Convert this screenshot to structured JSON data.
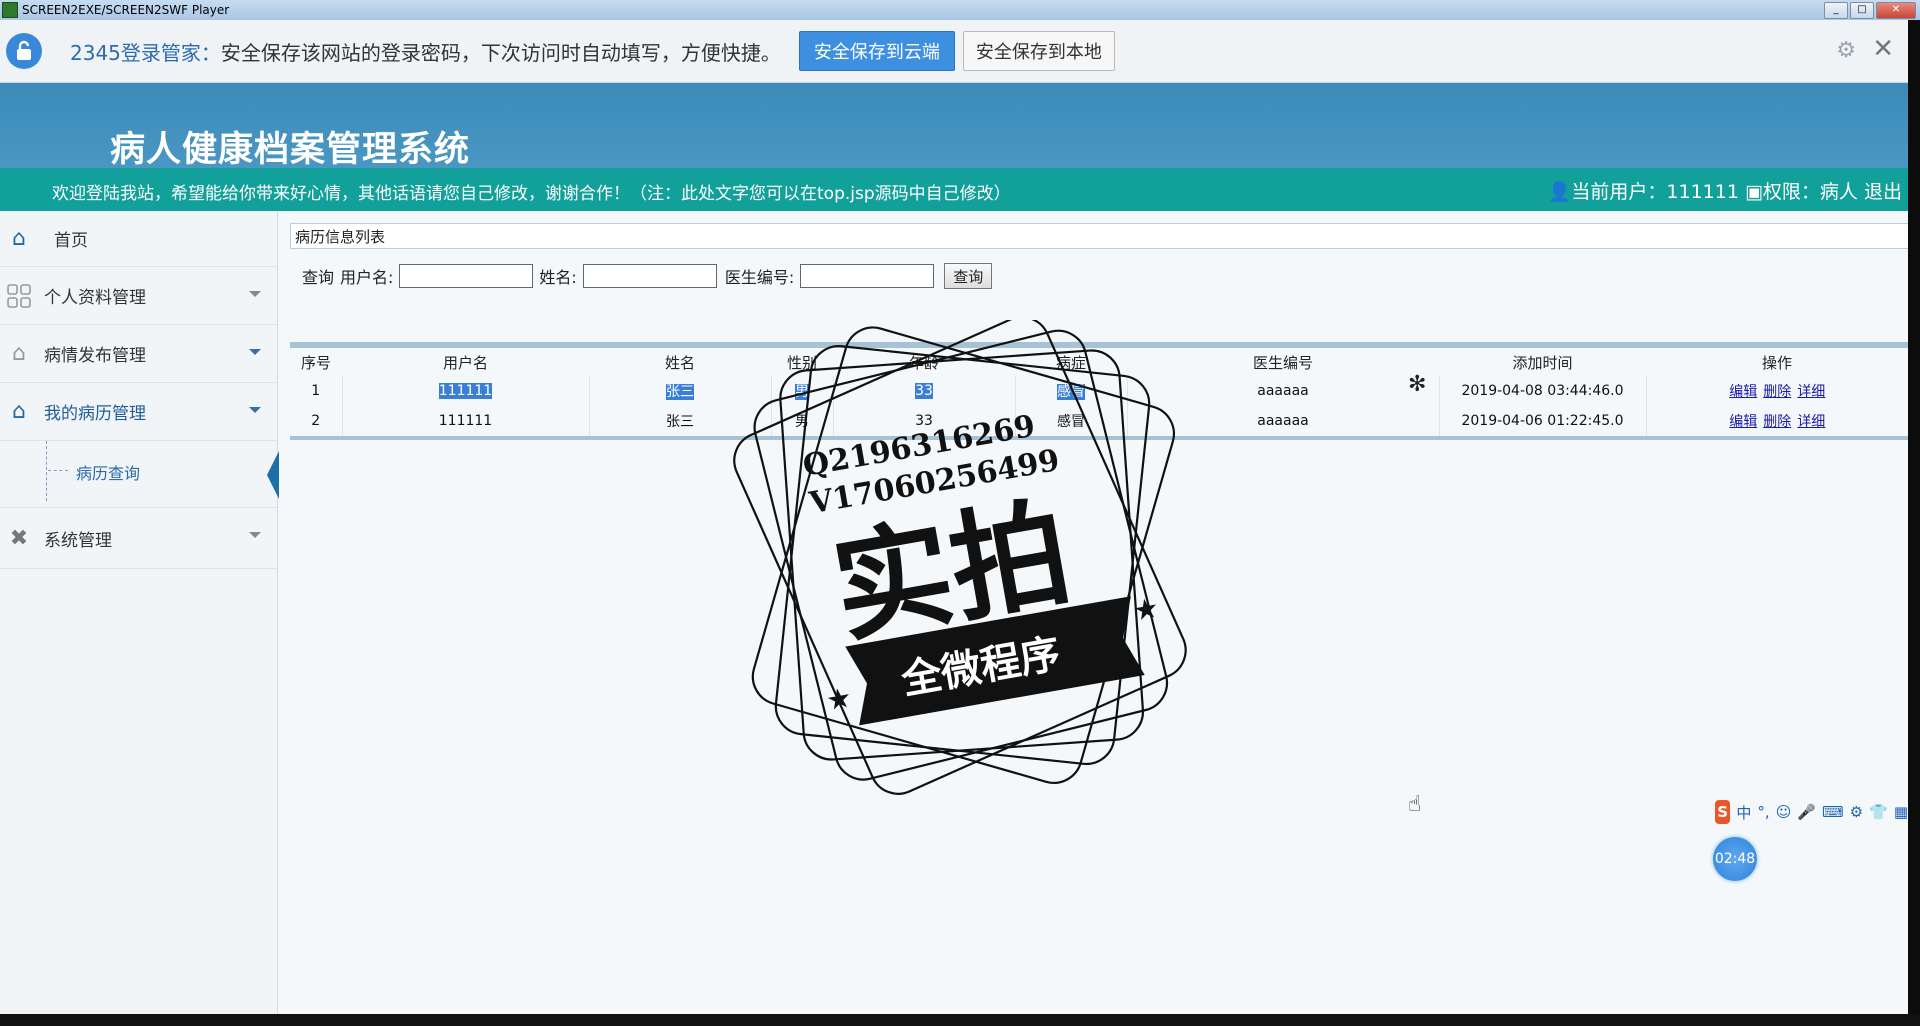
{
  "window": {
    "title": "SCREEN2EXE/SCREEN2SWF Player"
  },
  "password_bar": {
    "brand": "2345登录管家：",
    "message": "安全保存该网站的登录密码，下次访问时自动填写，方便快捷。",
    "save_cloud": "安全保存到云端",
    "save_local": "安全保存到本地"
  },
  "header": {
    "title": "病人健康档案管理系统"
  },
  "welcome": {
    "message": "欢迎登陆我站，希望能给你带来好心情，其他话语请您自己修改，谢谢合作！（注：此处文字您可以在top.jsp源码中自己修改）",
    "user": "当前用户：111111",
    "role": "权限：病人",
    "logout": "退出"
  },
  "sidebar": {
    "items": [
      {
        "label": "首页"
      },
      {
        "label": "个人资料管理"
      },
      {
        "label": "病情发布管理"
      },
      {
        "label": "我的病历管理"
      },
      {
        "label": "病历查询"
      },
      {
        "label": "系统管理"
      }
    ]
  },
  "panel": {
    "title": "病历信息列表"
  },
  "search": {
    "query_label": "查询",
    "username_label": "用户名:",
    "name_label": "姓名:",
    "doctor_label": "医生编号:",
    "button": "查询"
  },
  "table": {
    "headers": [
      "序号",
      "用户名",
      "姓名",
      "性别",
      "年龄",
      "病症",
      "医生编号",
      "添加时间",
      "操作"
    ],
    "rows": [
      {
        "no": "1",
        "user": "111111",
        "name": "张三",
        "gender": "男",
        "age": "33",
        "disease": "感冒",
        "doctor": "aaaaaa",
        "time": "2019-04-08 03:44:46.0"
      },
      {
        "no": "2",
        "user": "111111",
        "name": "张三",
        "gender": "男",
        "age": "33",
        "disease": "感冒",
        "doctor": "aaaaaa",
        "time": "2019-04-06 01:22:45.0"
      }
    ],
    "actions": [
      "编辑",
      "删除",
      "详细"
    ]
  },
  "watermark": {
    "line1": "Q2196316269",
    "line2": "V17060256499",
    "big": "实拍",
    "banner": "全微程序"
  },
  "ime": {
    "lang": "中",
    "punct": "°,"
  },
  "timer": {
    "value": "02:48"
  },
  "colors": {
    "header": "#3b8ab8",
    "welcome": "#12a09a",
    "accent": "#3d8fe0"
  }
}
